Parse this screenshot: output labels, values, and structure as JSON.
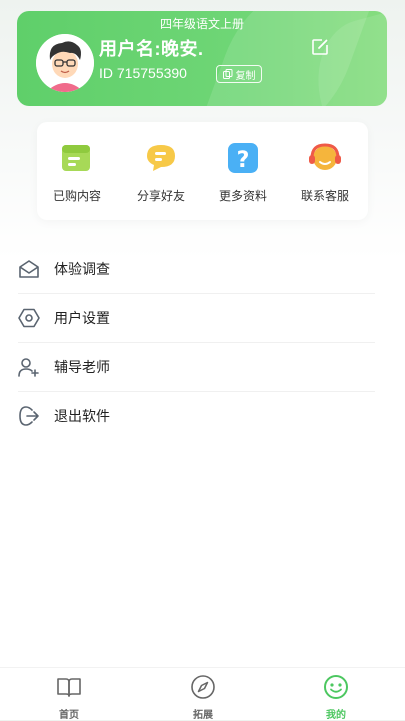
{
  "profile": {
    "grade": "四年级语文上册",
    "username": "用户名:晚安.",
    "id_text": "ID 715755390",
    "copy_label": "复制"
  },
  "quick_actions": [
    {
      "label": "已购内容",
      "icon": "scroll-icon"
    },
    {
      "label": "分享好友",
      "icon": "chat-bubble-icon"
    },
    {
      "label": "更多资料",
      "icon": "question-icon"
    },
    {
      "label": "联系客服",
      "icon": "headset-icon"
    }
  ],
  "menu": [
    {
      "label": "体验调查",
      "icon": "mail-icon"
    },
    {
      "label": "用户设置",
      "icon": "hexagon-settings-icon"
    },
    {
      "label": "辅导老师",
      "icon": "add-user-icon"
    },
    {
      "label": "退出软件",
      "icon": "logout-icon"
    }
  ],
  "tabs": [
    {
      "label": "首页",
      "icon": "book-icon",
      "active": false
    },
    {
      "label": "拓展",
      "icon": "compass-icon",
      "active": false
    },
    {
      "label": "我的",
      "icon": "smiley-icon",
      "active": true
    }
  ],
  "colors": {
    "accent": "#5fcf6a",
    "tab_active": "#4cc760"
  }
}
